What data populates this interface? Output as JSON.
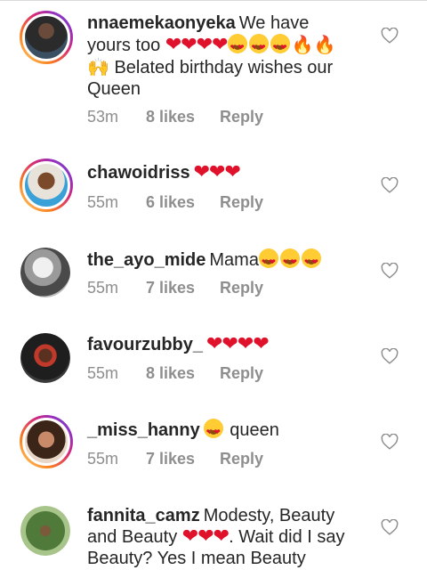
{
  "comments": [
    {
      "username": "nnaemekaonyeka",
      "text_parts": [
        "We have yours too",
        "Belated birthday wishes our Queen"
      ],
      "time": "53m",
      "likes": "8 likes",
      "reply": "Reply"
    },
    {
      "username": "chawoidriss",
      "time": "55m",
      "likes": "6 likes",
      "reply": "Reply"
    },
    {
      "username": "the_ayo_mide",
      "text": "Mama",
      "time": "55m",
      "likes": "7 likes",
      "reply": "Reply"
    },
    {
      "username": "favourzubby_",
      "time": "55m",
      "likes": "8 likes",
      "reply": "Reply"
    },
    {
      "username": "_miss_hanny",
      "text": "queen",
      "time": "55m",
      "likes": "7 likes",
      "reply": "Reply"
    },
    {
      "username": "fannita_camz",
      "text_parts": [
        "Modesty, Beauty and Beauty",
        ". Wait did I say Beauty? Yes I mean Beauty"
      ]
    }
  ],
  "icons": {
    "like": "heart-outline-icon",
    "emoji_heart": "red-heart-emoji",
    "emoji_heart_eyes": "heart-eyes-emoji",
    "emoji_fire": "fire-emoji",
    "emoji_raised_hands": "raised-hands-emoji"
  },
  "colors": {
    "meta": "#8e8e8e",
    "text": "#262626",
    "heart": "#e0112b"
  }
}
